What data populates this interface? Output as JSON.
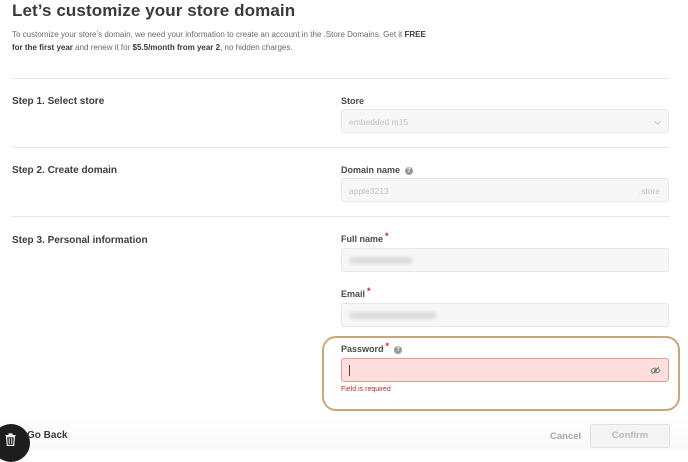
{
  "header": {
    "title": "Let’s customize your store domain",
    "intro_1": "To customize your store’s domain, we need your information to create an account in the .Store Domains. Get it ",
    "intro_bold_1": "FREE for the first year",
    "intro_2": " and renew it for ",
    "intro_bold_2": "$5.5/month from year 2",
    "intro_3": ", no hidden charges."
  },
  "steps": {
    "step1": "Step 1. Select store",
    "step2": "Step 2. Create domain",
    "step3": "Step 3. Personal information"
  },
  "fields": {
    "store": {
      "label": "Store",
      "value": "embedded m15"
    },
    "domain": {
      "label": "Domain name",
      "value": "apple3213",
      "suffix": ".store"
    },
    "full_name": {
      "label": "Full name",
      "required_mark": "*"
    },
    "email": {
      "label": "Email",
      "required_mark": "*"
    },
    "password": {
      "label": "Password",
      "required_mark": "*",
      "value": "",
      "error": "Field is required"
    }
  },
  "footer": {
    "go_back": "Go Back",
    "cancel": "Cancel",
    "confirm": "Confirm"
  },
  "colors": {
    "error": "#c62828",
    "error_field_bg": "#ffdede",
    "highlight_border": "#c9a77a"
  }
}
